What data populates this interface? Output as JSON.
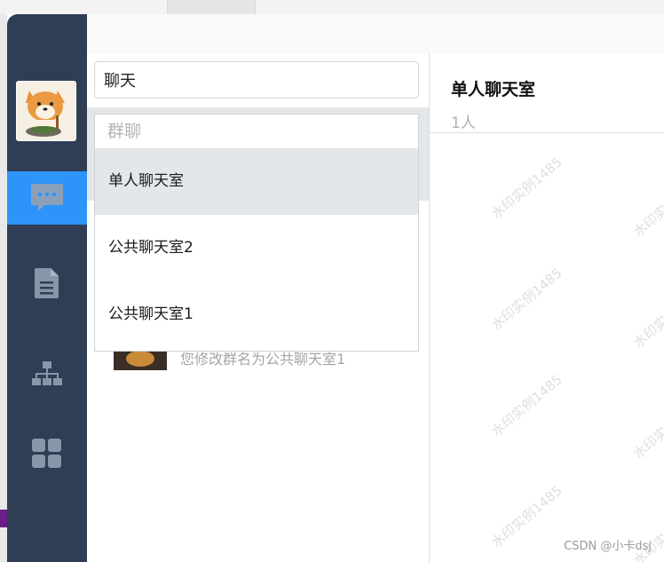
{
  "search": {
    "value": "聊天"
  },
  "dropdown": {
    "group_label": "群聊",
    "items": [
      {
        "label": "单人聊天室"
      },
      {
        "label": "公共聊天室2"
      },
      {
        "label": "公共聊天室1"
      }
    ]
  },
  "conversation_list": {
    "partial_item_text": "您修改群名为公共聊天室1"
  },
  "chat": {
    "title": "单人聊天室",
    "member_count": "1人"
  },
  "watermark": {
    "text": "水印实例1485"
  },
  "credit": "CSDN @小卡dsj",
  "colors": {
    "sidebar": "#2f3e55",
    "accent": "#2d94fa",
    "hover": "#e4e7ea"
  },
  "nav": [
    {
      "name": "chat",
      "icon": "chat-bubble-icon",
      "active": true
    },
    {
      "name": "documents",
      "icon": "document-icon",
      "active": false
    },
    {
      "name": "organization",
      "icon": "org-chart-icon",
      "active": false
    },
    {
      "name": "apps",
      "icon": "grid-icon",
      "active": false
    }
  ]
}
